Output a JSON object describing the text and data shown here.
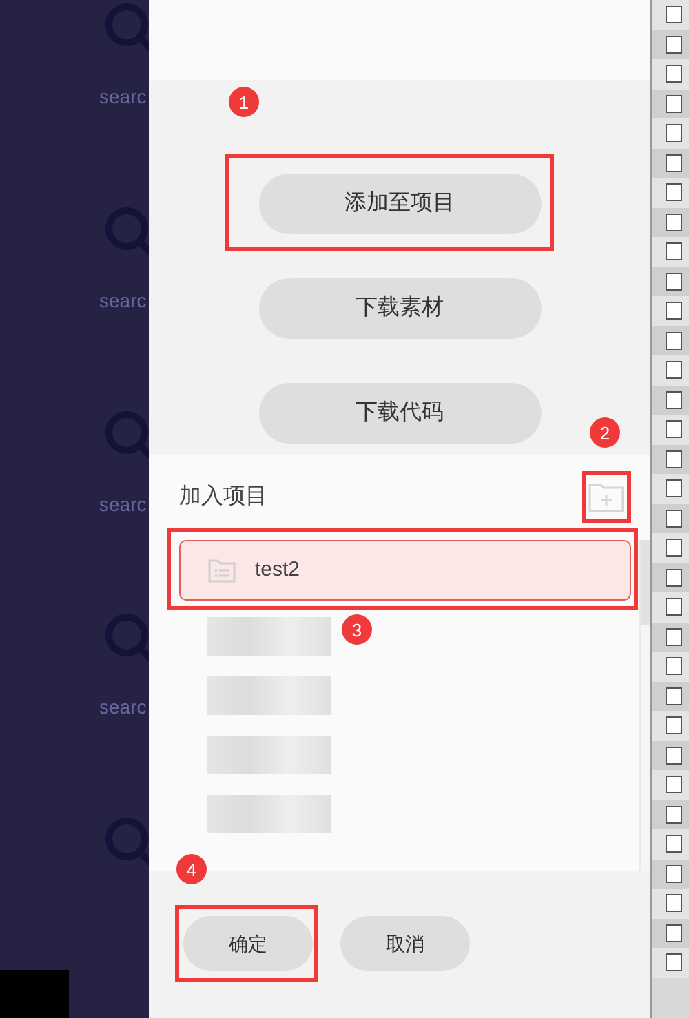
{
  "background": {
    "tiles": [
      {
        "kind": "captioned",
        "caption": "searc"
      },
      {
        "kind": "captioned",
        "caption": "searc"
      },
      {
        "kind": "captioned",
        "caption": "searc"
      },
      {
        "kind": "captioned",
        "caption": "searc"
      },
      {
        "kind": "icon"
      }
    ]
  },
  "actions": [
    {
      "label": "添加至项目"
    },
    {
      "label": "下载素材"
    },
    {
      "label": "下载代码"
    }
  ],
  "projects": {
    "title": "加入项目",
    "items": [
      {
        "label": "test2",
        "selected": true,
        "redacted": false
      },
      {
        "selected": false,
        "redacted": true
      },
      {
        "selected": false,
        "redacted": true
      },
      {
        "selected": false,
        "redacted": true
      },
      {
        "selected": false,
        "redacted": true
      }
    ]
  },
  "footer": {
    "buttons": [
      {
        "label": "确定"
      },
      {
        "label": "取消"
      }
    ]
  },
  "annotations": [
    "1",
    "2",
    "3",
    "4"
  ],
  "side_checkboxes": [
    {
      "checked": false
    },
    {
      "checked": false
    },
    {
      "checked": false
    },
    {
      "checked": false
    },
    {
      "checked": false
    },
    {
      "checked": false
    },
    {
      "checked": false
    },
    {
      "checked": false
    },
    {
      "checked": false
    },
    {
      "checked": false
    },
    {
      "checked": false
    },
    {
      "checked": false
    },
    {
      "checked": false
    },
    {
      "checked": false
    },
    {
      "checked": false
    },
    {
      "checked": false
    },
    {
      "checked": false
    },
    {
      "checked": false
    },
    {
      "checked": false
    },
    {
      "checked": false
    },
    {
      "checked": false
    },
    {
      "checked": false
    },
    {
      "checked": false
    },
    {
      "checked": false
    },
    {
      "checked": false
    },
    {
      "checked": false
    },
    {
      "checked": false
    },
    {
      "checked": false
    },
    {
      "checked": false
    },
    {
      "checked": false
    },
    {
      "checked": false
    },
    {
      "checked": false
    },
    {
      "checked": false
    }
  ]
}
